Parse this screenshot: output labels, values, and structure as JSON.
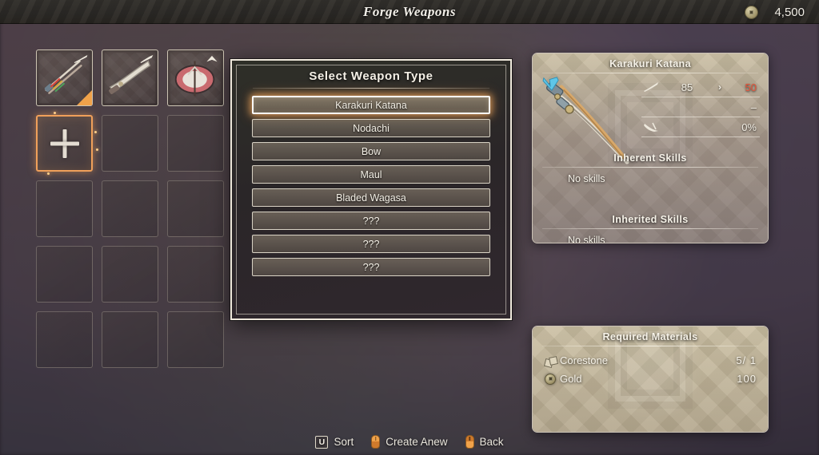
{
  "header": {
    "title": "Forge Weapons",
    "currency_icon": "coin-icon",
    "currency_amount": "4,500"
  },
  "inventory": {
    "slots": [
      {
        "name": "Karakuri Katana",
        "filled": true,
        "type_icon": "katana-icon",
        "new_marker": true
      },
      {
        "name": "Nodachi",
        "filled": true,
        "type_icon": "nodachi-icon",
        "new_marker": false
      },
      {
        "name": "Bladed Wagasa",
        "filled": true,
        "type_icon": "wagasa-icon",
        "new_marker": false
      },
      {
        "name": "Add Weapon",
        "filled": false,
        "add": true,
        "label": "+"
      },
      {
        "name": "Empty Slot",
        "filled": false
      },
      {
        "name": "Empty Slot",
        "filled": false
      },
      {
        "name": "Empty Slot",
        "filled": false
      },
      {
        "name": "Empty Slot",
        "filled": false
      },
      {
        "name": "Empty Slot",
        "filled": false
      },
      {
        "name": "Empty Slot",
        "filled": false
      },
      {
        "name": "Empty Slot",
        "filled": false
      },
      {
        "name": "Empty Slot",
        "filled": false
      },
      {
        "name": "Empty Slot",
        "filled": false
      },
      {
        "name": "Empty Slot",
        "filled": false
      },
      {
        "name": "Empty Slot",
        "filled": false
      }
    ]
  },
  "modal": {
    "title": "Select Weapon Type",
    "options": [
      {
        "label": "Karakuri Katana",
        "selected": true
      },
      {
        "label": "Nodachi",
        "selected": false
      },
      {
        "label": "Bow",
        "selected": false
      },
      {
        "label": "Maul",
        "selected": false
      },
      {
        "label": "Bladed Wagasa",
        "selected": false
      },
      {
        "label": "???",
        "selected": false
      },
      {
        "label": "???",
        "selected": false
      },
      {
        "label": "???",
        "selected": false
      }
    ]
  },
  "weapon_panel": {
    "title": "Karakuri Katana",
    "rarity_icon": "rarity-chevron-icon",
    "art_icon": "katana-art",
    "stats": [
      {
        "icon": "attack-sword-icon",
        "base": "85",
        "arrow": "›",
        "new": "50",
        "trend": "down"
      },
      {
        "icon": "",
        "base": "",
        "arrow": "",
        "new": "–",
        "trend": "plain"
      },
      {
        "icon": "crit-blade-icon",
        "base": "",
        "arrow": "",
        "new": "0%",
        "trend": "plain"
      }
    ],
    "inherent_skills": {
      "title": "Inherent Skills",
      "value": "No skills"
    },
    "inherited_skills": {
      "title": "Inherited Skills",
      "value": "No skills"
    }
  },
  "materials_panel": {
    "title": "Required Materials",
    "items": [
      {
        "icon": "ore-icon",
        "name": "Corestone",
        "qty": "5/  1"
      },
      {
        "icon": "coin-icon",
        "name": "Gold",
        "qty": "100"
      }
    ]
  },
  "hints": [
    {
      "key": "U",
      "key_type": "keycap",
      "label": "Sort"
    },
    {
      "key": "",
      "key_type": "mouse-left",
      "label": "Create Anew"
    },
    {
      "key": "",
      "key_type": "mouse-right",
      "label": "Back"
    }
  ],
  "colors": {
    "accent_orange": "#f0a24a",
    "decrease_red": "#e8543a",
    "panel_tan": "#c9bda0",
    "text_light": "#f4f0e6"
  }
}
